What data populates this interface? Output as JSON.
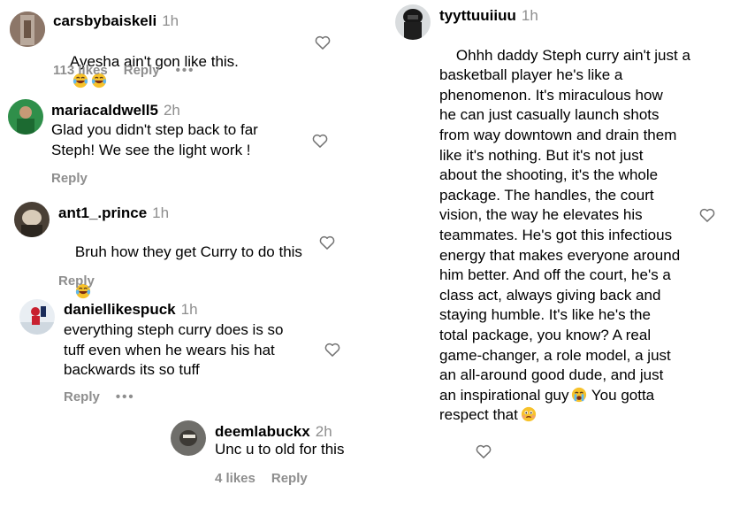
{
  "comments": [
    {
      "username": "carsbybaiskeli",
      "time": "1h",
      "text": "Ayesha ain't gon like this.",
      "emojis": [
        "laughing-crying-emoji",
        "laughing-crying-emoji"
      ],
      "likes": "113 likes",
      "reply": "Reply",
      "more": "•••"
    },
    {
      "username": "mariacaldwell5",
      "time": "2h",
      "text": "Glad you didn't step back to far\nSteph! We see the light work !",
      "reply": "Reply"
    },
    {
      "username": "ant1_.prince",
      "time": "1h",
      "text": "Bruh how they get Curry to do this",
      "emojis": [
        "laughing-crying-emoji"
      ],
      "reply": "Reply"
    },
    {
      "username": "daniellikespuck",
      "time": "1h",
      "text": "everything steph curry does is so\ntuff even when he wears his hat\nbackwards its so tuff",
      "reply": "Reply",
      "more": "•••"
    },
    {
      "username": "deemlabuckx",
      "time": "2h",
      "text": "Unc u to old for this",
      "likes": "4 likes",
      "reply": "Reply"
    },
    {
      "username": "tyyttuuiiuu",
      "time": "1h",
      "text": "Ohhh daddy Steph curry ain't just a\nbasketball player he's like a\nphenomenon. It's miraculous how\nhe can just casually launch shots\nfrom way downtown and drain them\nlike it's nothing. But it's not just\nabout the shooting, it's the whole\npackage. The handles, the court\nvision, the way he elevates his\nteammates. He's got this infectious\nenergy that makes everyone around\nhim better. And off the court, he's a\nclass act, always giving back and\nstaying humble. It's like he's the\ntotal package, you know? A real\ngame-changer, a role model, a just\nan all-around good dude, and just\nan inspirational guy",
      "text_tail_1": "You gotta",
      "text_tail_2": "respect that",
      "emojis": [
        "weeping-emoji",
        "face-holding-back-tears-emoji"
      ]
    }
  ]
}
